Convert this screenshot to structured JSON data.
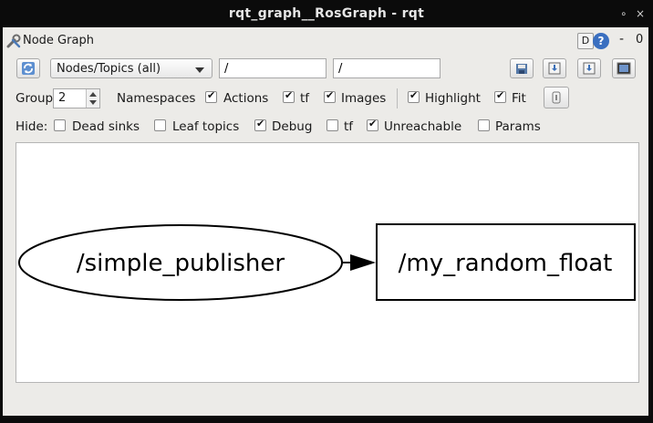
{
  "window": {
    "title": "rqt_graph__RosGraph - rqt",
    "close_glyph": "×",
    "pin_glyph": "∘"
  },
  "plugin": {
    "name": "Node Graph",
    "d_label": "D",
    "help_label": "?",
    "minimize_label": "-",
    "close_label": "0"
  },
  "toolbar": {
    "graph_type": "Nodes/Topics (all)",
    "node_filter": "/",
    "topic_filter": "/"
  },
  "group_row": {
    "group_label": "Group:",
    "group_value": "2",
    "namespaces_label": "Namespaces",
    "actions_label": "Actions",
    "tf_label": "tf",
    "images_label": "Images",
    "highlight_label": "Highlight",
    "fit_label": "Fit",
    "namespaces_checked": true,
    "actions_checked": true,
    "tf_checked": true,
    "images_checked": true,
    "highlight_checked": true,
    "fit_checked": true
  },
  "hide_row": {
    "hide_label": "Hide:",
    "dead_sinks_label": "Dead sinks",
    "leaf_topics_label": "Leaf topics",
    "debug_label": "Debug",
    "tf_label": "tf",
    "unreachable_label": "Unreachable",
    "params_label": "Params",
    "dead_sinks_checked": false,
    "leaf_topics_checked": false,
    "debug_checked": true,
    "tf_checked": false,
    "unreachable_checked": true,
    "params_checked": false
  },
  "graph": {
    "node_name": "/simple_publisher",
    "topic_name": "/my_random_float"
  },
  "colors": {
    "title_bg": "#0b0b0b",
    "panel_bg": "#ecebe8",
    "help_blue": "#3a6fc0"
  }
}
